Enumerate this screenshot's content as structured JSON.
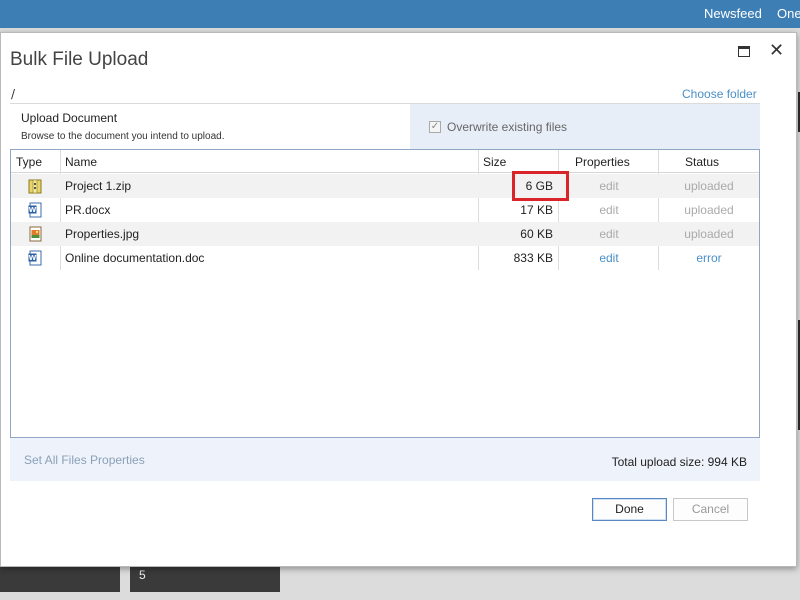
{
  "topbar": {
    "links": [
      "Newsfeed",
      "One"
    ]
  },
  "background": {
    "tile_number": "5"
  },
  "dialog": {
    "title": "Bulk File Upload",
    "path": "/",
    "choose_folder": "Choose folder",
    "upload": {
      "heading": "Upload Document",
      "description": "Browse to the document you intend to upload."
    },
    "overwrite": {
      "label": "Overwrite existing files",
      "checked": true
    },
    "table": {
      "columns": [
        "Type",
        "Name",
        "Size",
        "Properties",
        "Status"
      ],
      "rows": [
        {
          "icon": "zip-file-icon",
          "name": "Project 1.zip",
          "size": "6 GB",
          "properties": "edit",
          "status": "uploaded"
        },
        {
          "icon": "word-doc-icon",
          "name": "PR.docx",
          "size": "17 KB",
          "properties": "edit",
          "status": "uploaded"
        },
        {
          "icon": "image-file-icon",
          "name": "Properties.jpg",
          "size": "60 KB",
          "properties": "edit",
          "status": "uploaded"
        },
        {
          "icon": "word-doc-icon",
          "name": "Online documentation.doc",
          "size": "833 KB",
          "properties": "edit",
          "status": "error"
        }
      ]
    },
    "footer": {
      "set_all": "Set All Files Properties",
      "total": "Total upload size: 994 KB"
    },
    "buttons": {
      "done": "Done",
      "cancel": "Cancel"
    }
  },
  "colors": {
    "topbar": "#3d7eb5",
    "link": "#4a90c8",
    "highlight": "#d9252a",
    "panel": "#eef2fa"
  }
}
